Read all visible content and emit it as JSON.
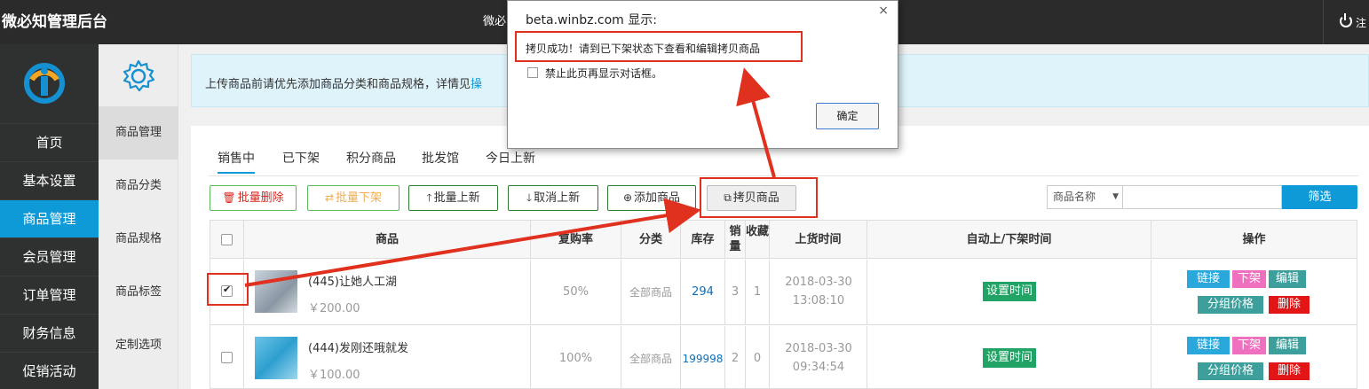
{
  "topbar": {
    "brand": "微必知管理后台",
    "center_text": "微必",
    "right_text": "注"
  },
  "leftnav": {
    "items": [
      "首页",
      "基本设置",
      "商品管理",
      "会员管理",
      "订单管理",
      "财务信息",
      "促销活动"
    ],
    "active": "商品管理"
  },
  "subnav": {
    "items": [
      "商品管理",
      "商品分类",
      "商品规格",
      "商品标签",
      "定制选项"
    ],
    "active": "商品管理"
  },
  "notice": {
    "text": "上传商品前请优先添加商品分类和商品规格，详情见",
    "link": "操"
  },
  "tabs": [
    "销售中",
    "已下架",
    "积分商品",
    "批发馆",
    "今日上新"
  ],
  "toolbar": {
    "batch_delete": "批量删除",
    "batch_offshelf": "批量下架",
    "batch_new": "批量上新",
    "cancel_new": "取消上新",
    "add_product": "添加商品",
    "copy_product": "拷贝商品"
  },
  "search": {
    "select_value": "商品名称",
    "button": "筛选"
  },
  "table": {
    "headers": {
      "product": "商品",
      "repurchase": "复购率",
      "category": "分类",
      "stock": "库存",
      "sales": "销量",
      "favorites": "收藏",
      "shelf_time": "上货时间",
      "auto_time": "自动上/下架时间",
      "actions": "操作"
    },
    "rows": [
      {
        "checked": true,
        "name": "(445)让她人工湖",
        "price": "￥200.00",
        "repurchase": "50%",
        "category": "全部商品",
        "stock": "294",
        "sales": "3",
        "favorites": "1",
        "date": "2018-03-30",
        "time": "13:08:10",
        "set_time": "设置时间"
      },
      {
        "checked": false,
        "name": "(444)发刚还哦就发",
        "price": "￥100.00",
        "repurchase": "100%",
        "category": "全部商品",
        "stock": "199998",
        "sales": "2",
        "favorites": "0",
        "date": "2018-03-30",
        "time": "09:34:54",
        "set_time": "设置时间"
      }
    ],
    "action_labels": {
      "link": "链接",
      "offshelf": "下架",
      "edit": "编辑",
      "group_price": "分组价格",
      "delete": "删除"
    }
  },
  "dialog": {
    "title": "beta.winbz.com 显示:",
    "close": "×",
    "message": "拷贝成功！请到已下架状态下查看和编辑拷贝商品",
    "checkbox_label": "禁止此页再显示对话框。",
    "ok": "确定"
  },
  "colors": {
    "accent": "#0e9ad7",
    "topbar": "#2b2b2b",
    "annotation": "#e0301e"
  }
}
